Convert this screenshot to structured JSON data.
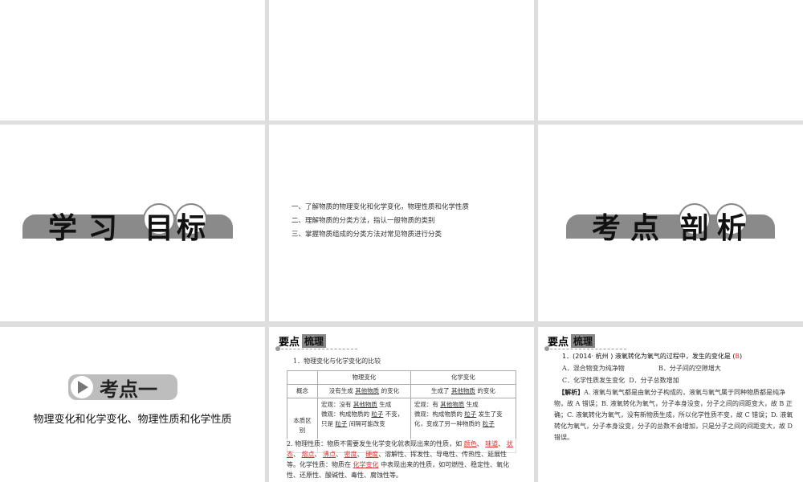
{
  "slide_objectives": {
    "chars": [
      "学",
      "习",
      "目",
      "标"
    ]
  },
  "slide_goals": {
    "items": [
      "一、了解物质的物理变化和化学变化，物理性质和化学性质",
      "二、理解物质的分类方法，指认一般物质的类别",
      "三、掌握物质组成的分类方法对常见物质进行分类"
    ]
  },
  "slide_analysis": {
    "chars": [
      "考",
      "点",
      "剖",
      "析"
    ]
  },
  "slide_point": {
    "badge": "考点一",
    "subtitle": "物理变化和化学变化、物理性质和化学性质"
  },
  "slide_summary": {
    "head1": "要点",
    "head2": "梳理",
    "title": "1．物理变化与化学变化的比较",
    "table": {
      "headers": [
        "",
        "物理变化",
        "化学变化"
      ],
      "row1": {
        "label": "概念",
        "phys_pre": "没有生成",
        "phys_blank": "其他物质",
        "phys_post": "的变化",
        "chem_pre": "生成了",
        "chem_blank": "其他物质",
        "chem_post": "的变化"
      },
      "row2": {
        "label": "本质区别",
        "phys_macro_pre": "宏观：没有",
        "phys_macro_blank": "其他物质",
        "phys_macro_post": "生成",
        "phys_micro": "微观：构成物质的",
        "phys_micro_blank": "粒子",
        "phys_micro_post": "不变，只是",
        "phys_micro_blank2": "粒子",
        "phys_micro_post2": "间隔可能改变",
        "chem_macro_pre": "宏观：有",
        "chem_macro_blank": "其他物质",
        "chem_macro_post": "生成",
        "chem_micro": "微观：构成物质的",
        "chem_micro_blank": "粒子",
        "chem_micro_post": "发生了变化，变成了另一种物质的",
        "chem_micro_blank2": "粒子"
      }
    },
    "p2_pre": "2. 物理性质：物质不需要发生化学变化就表现出来的性质，如",
    "blanks": [
      "颜色",
      "味道",
      "状态",
      "熔点",
      "沸点",
      "密度",
      "硬度"
    ],
    "p2_mid": "、溶解性、挥发性、导电性、传热性、延展性等。化学性质：物质在",
    "p2_blank": "化学变化",
    "p2_post": "中表现出来的性质，如可燃性、稳定性、氧化性、还原性、酸碱性、毒性、腐蚀性等。"
  },
  "slide_exercise": {
    "head1": "要点",
    "head2": "梳理",
    "question": "1．(2014· 杭州 ) 液氧转化为氧气的过程中，发生的变化是 (",
    "answer": "B",
    "close": ")",
    "options": [
      "A．混合物变为纯净物",
      "B．分子间的空隙增大",
      "C．化学性质发生变化",
      "D．分子总数增加"
    ],
    "analysis_label": "【解析】",
    "analysis": "A. 液氧与氧气都是由氧分子构成的，液氧与氧气属于同种物质都是纯净物，故 A 错误；B. 液氧转化为氧气，分子本身没变，分子之间的间距变大，故 B 正确；C. 液氧转化为氧气，没有新物质生成，所以化学性质不变，故 C 错误；D. 液氧转化为氧气，分子本身没变，分子的总数不会增加，只是分子之间的间距变大，故 D 错误。"
  }
}
